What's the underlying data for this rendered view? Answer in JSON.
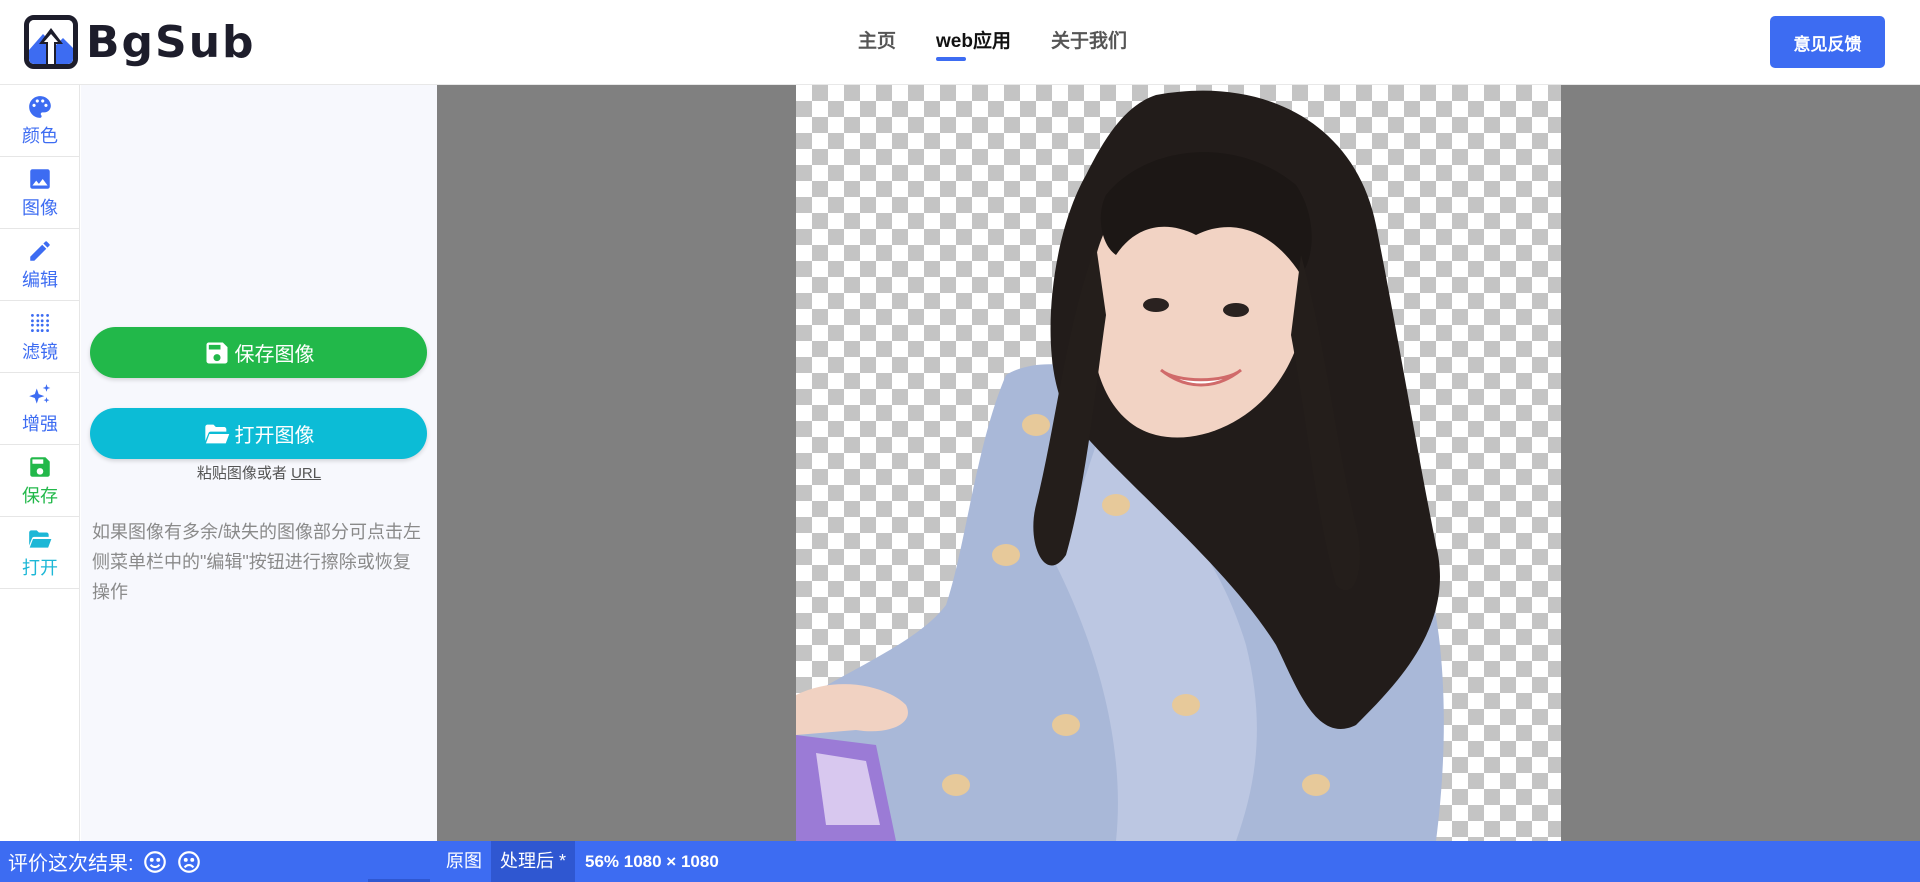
{
  "header": {
    "logo_text": "BgSub",
    "nav": [
      {
        "label": "主页",
        "active": false
      },
      {
        "label": "web应用",
        "active": true
      },
      {
        "label": "关于我们",
        "active": false
      }
    ],
    "feedback_label": "意见反馈"
  },
  "sidebar": {
    "items": [
      {
        "label": "颜色",
        "icon": "palette-icon",
        "color": "#3d6cf2"
      },
      {
        "label": "图像",
        "icon": "image-icon",
        "color": "#3d6cf2"
      },
      {
        "label": "编辑",
        "icon": "pencil-icon",
        "color": "#3d6cf2"
      },
      {
        "label": "滤镜",
        "icon": "dots-grid-icon",
        "color": "#3d6cf2"
      },
      {
        "label": "增强",
        "icon": "sparkle-icon",
        "color": "#3d6cf2"
      },
      {
        "label": "保存",
        "icon": "floppy-icon",
        "color": "#22b84a"
      },
      {
        "label": "打开",
        "icon": "folder-open-icon",
        "color": "#1cb7d6"
      }
    ]
  },
  "panel": {
    "save_label": "保存图像",
    "open_label": "打开图像",
    "paste_hint_prefix": "粘贴图像或者",
    "paste_hint_link": "URL",
    "tip": "如果图像有多余/缺失的图像部分可点击左侧菜单栏中的\"编辑\"按钮进行擦除或恢复操作"
  },
  "statusbar": {
    "rate_label": "评价这次结果:",
    "tabs": [
      {
        "label": "原图",
        "active": false
      },
      {
        "label": "处理后 *",
        "active": true
      }
    ],
    "zoom_info": "56% 1080 × 1080"
  },
  "colors": {
    "accent": "#3d6cf2",
    "save_green": "#22b84a",
    "open_cyan": "#0cbcd6",
    "canvas_bg": "#808080"
  }
}
